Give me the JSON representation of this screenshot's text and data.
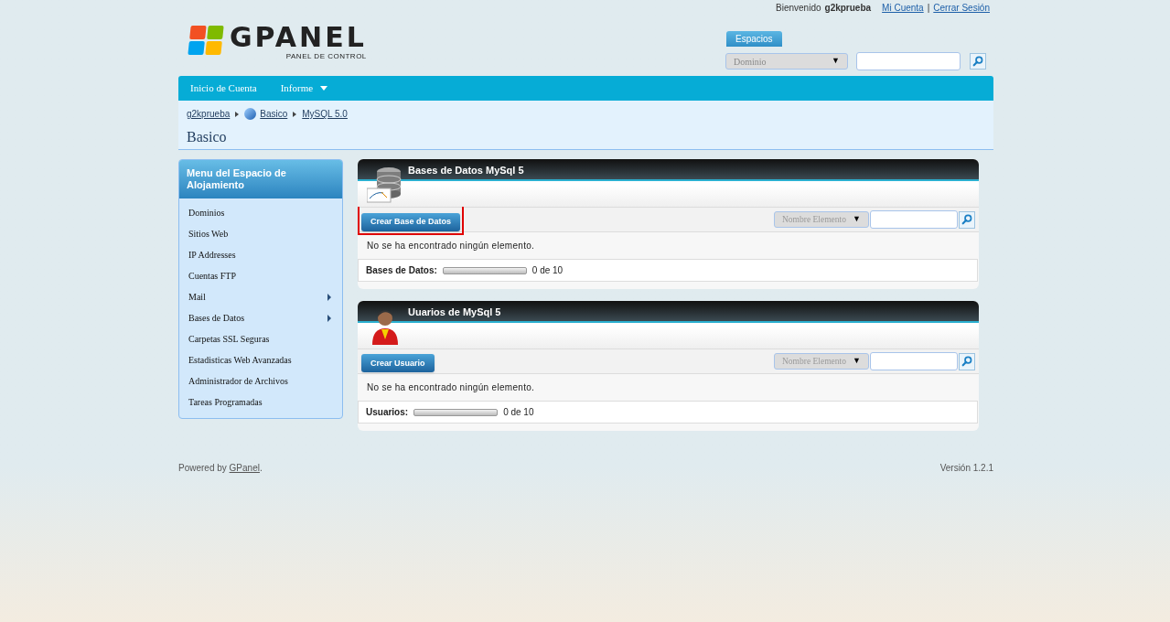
{
  "top_bar": {
    "welcome": "Bienvenido",
    "user": "g2kprueba",
    "links": [
      "Mi Cuenta",
      "Cerrar Sesión"
    ],
    "separator": "|"
  },
  "logo": {
    "name": "GPANEL",
    "tagline": "PANEL DE CONTROL"
  },
  "spaces": {
    "label": "Espacios",
    "select": "Dominio",
    "caret": "▼"
  },
  "nav": [
    {
      "label": "Inicio de Cuenta",
      "dropdown": false
    },
    {
      "label": "Informe",
      "dropdown": true
    }
  ],
  "breadcrumb": [
    {
      "label": "g2kprueba",
      "kind": "text"
    },
    {
      "label": "Basico",
      "kind": "globe"
    },
    {
      "label": "MySQL 5.0",
      "kind": "text"
    }
  ],
  "page_title": "Basico",
  "sidebar": {
    "title": "Menu del Espacio de Alojamiento",
    "items": [
      {
        "label": "Dominios",
        "submenu": false
      },
      {
        "label": "Sitios Web",
        "submenu": false
      },
      {
        "label": "IP Addresses",
        "submenu": false
      },
      {
        "label": "Cuentas FTP",
        "submenu": false
      },
      {
        "label": "Mail",
        "submenu": true
      },
      {
        "label": "Bases de Datos",
        "submenu": true
      },
      {
        "label": "Carpetas SSL Seguras",
        "submenu": false
      },
      {
        "label": "Estadisticas Web Avanzadas",
        "submenu": false
      },
      {
        "label": "Administrador de Archivos",
        "submenu": false
      },
      {
        "label": "Tareas Programadas",
        "submenu": false
      }
    ]
  },
  "panels": [
    {
      "kind": "database",
      "title": "Bases de Datos MySql 5",
      "button": "Crear Base de Datos",
      "highlighted": true,
      "filter": "Nombre Elemento",
      "caret": "▼",
      "empty": "No se ha encontrado ningún elemento.",
      "quota_label": "Bases de Datos:",
      "level": 0,
      "quota": "0 de 10"
    },
    {
      "kind": "user",
      "title": "Uuarios de MySql 5",
      "button": "Crear Usuario",
      "highlighted": false,
      "filter": "Nombre Elemento",
      "caret": "▼",
      "empty": "No se ha encontrado ningún elemento.",
      "quota_label": "Usuarios:",
      "level": 0,
      "quota": "0 de 10"
    }
  ],
  "footer": {
    "prefix": "Powered by",
    "link": "GPanel",
    "suffix": ".",
    "version": "Versión 1.2.1"
  }
}
